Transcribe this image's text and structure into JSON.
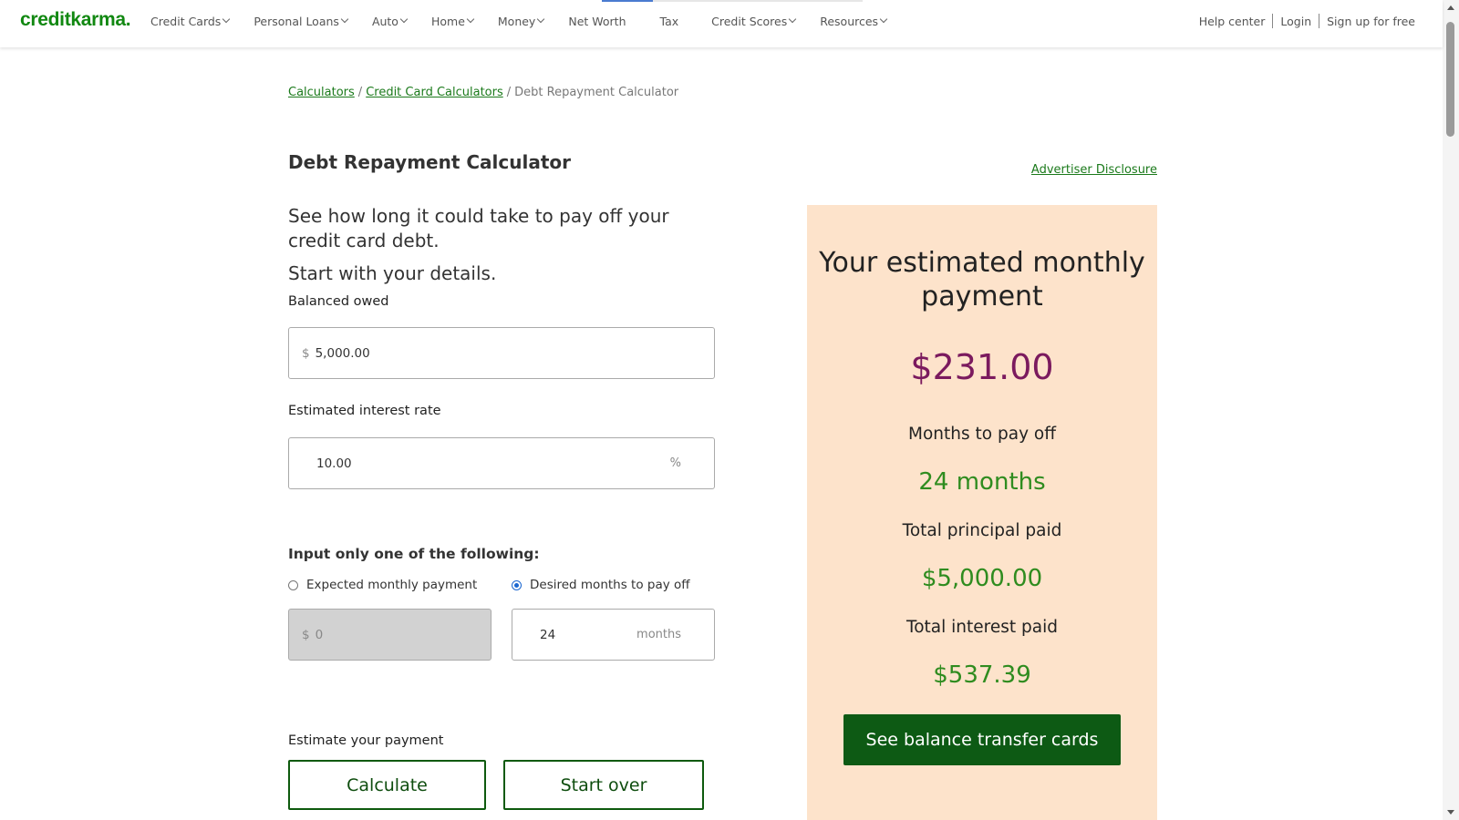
{
  "brand": {
    "logo_text": "creditkarma",
    "logo_dot": ".",
    "color": "#118811"
  },
  "nav": {
    "items": [
      {
        "label": "Credit Cards",
        "dropdown": true
      },
      {
        "label": "Personal Loans",
        "dropdown": true
      },
      {
        "label": "Auto",
        "dropdown": true
      },
      {
        "label": "Home",
        "dropdown": true
      },
      {
        "label": "Money",
        "dropdown": true
      },
      {
        "label": "Net Worth",
        "dropdown": false
      },
      {
        "label": "Tax",
        "dropdown": false
      },
      {
        "label": "Credit Scores",
        "dropdown": true
      },
      {
        "label": "Resources",
        "dropdown": true
      }
    ],
    "help": "Help center",
    "login": "Login",
    "signup": "Sign up for free"
  },
  "breadcrumb": {
    "calculators": "Calculators",
    "credit_card_calculators": "Credit Card Calculators",
    "current": "Debt Repayment Calculator",
    "separator": "/"
  },
  "page": {
    "title": "Debt Repayment Calculator",
    "disclosure": "Advertiser Disclosure",
    "intro": "See how long it could take to pay off your credit card debt.",
    "intro2": "Start with your details."
  },
  "form": {
    "balance": {
      "label": "Balanced owed",
      "prefix": "$",
      "value": "5,000.00"
    },
    "interest": {
      "label": "Estimated interest rate",
      "value": "10.00",
      "suffix": "%"
    },
    "choose_heading": "Input only one of the following:",
    "option_monthly": {
      "label": "Expected monthly payment",
      "checked": false,
      "prefix": "$",
      "value": "0"
    },
    "option_months": {
      "label": "Desired months to pay off",
      "checked": true,
      "value": "24",
      "suffix": "months"
    },
    "estimate_label": "Estimate your payment",
    "calculate": "Calculate",
    "start_over": "Start over"
  },
  "result": {
    "title": "Your estimated monthly payment",
    "monthly_payment": "$231.00",
    "months_label": "Months to pay off",
    "months_value": "24 months",
    "principal_label": "Total principal paid",
    "principal_value": "$5,000.00",
    "interest_label": "Total interest paid",
    "interest_value": "$537.39",
    "cta": "See balance transfer cards",
    "panel_color": "#fde3cb",
    "amount_color": "#7b1a5e",
    "value_color": "#2f8c1f",
    "cta_color": "#0d5a14"
  }
}
